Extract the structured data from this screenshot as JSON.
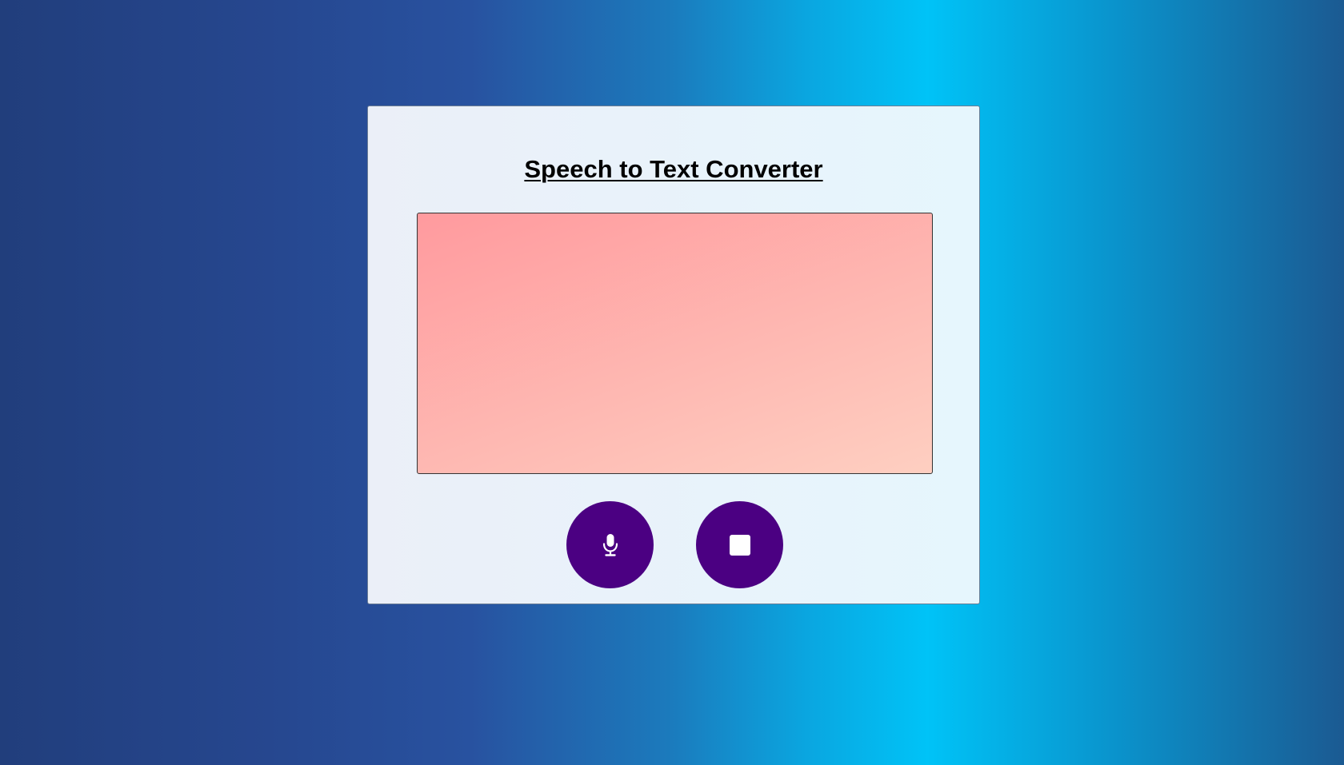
{
  "app": {
    "title": "Speech to Text Converter"
  },
  "transcript": {
    "value": "",
    "placeholder": ""
  },
  "controls": {
    "start": {
      "icon": "microphone-icon"
    },
    "stop": {
      "icon": "stop-icon"
    }
  },
  "colors": {
    "button_background": "#4b0082",
    "textarea_gradient_start": "#ff9a9e",
    "textarea_gradient_end": "#fecfc1",
    "card_background": "#ebeff8"
  }
}
